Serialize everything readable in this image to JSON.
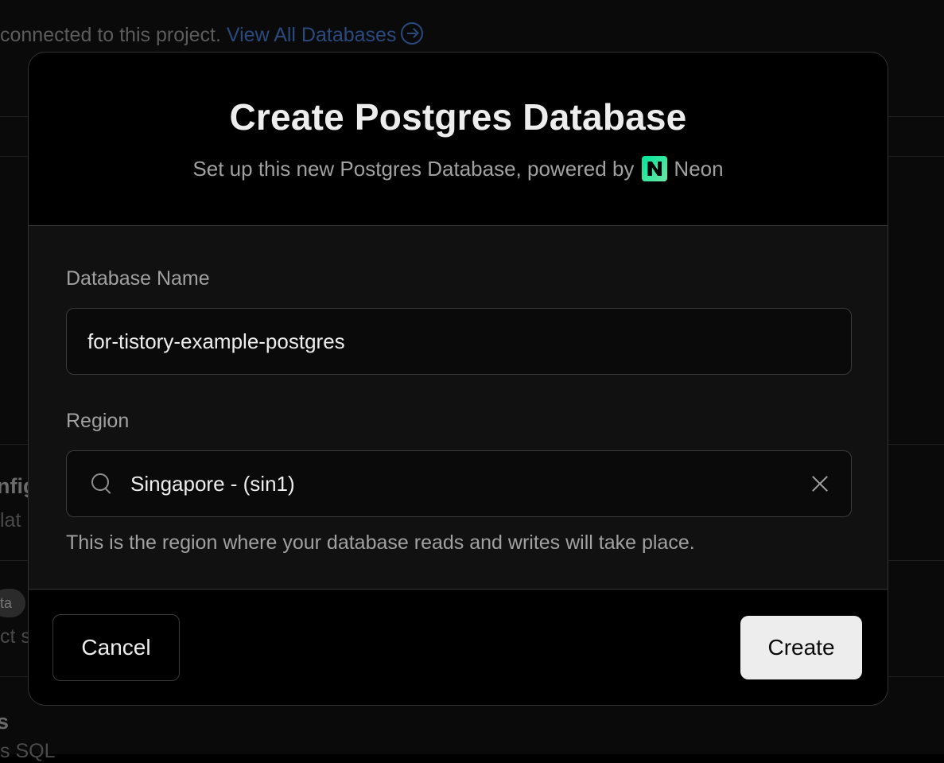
{
  "background": {
    "top_text": "connected to this project.",
    "top_link": "View All Databases",
    "fragment_1": "nfig",
    "fragment_2": "lat",
    "fragment_3": "ct s",
    "fragment_4": "s",
    "fragment_5": "s SQL",
    "pill": "ta"
  },
  "modal": {
    "title": "Create Postgres Database",
    "subtitle": "Set up this new Postgres Database, powered by",
    "provider": "Neon",
    "database_name_label": "Database Name",
    "database_name_value": "for-tistory-example-postgres",
    "region_label": "Region",
    "region_value": "Singapore - (sin1)",
    "region_help": "This is the region where your database reads and writes will take place.",
    "cancel_label": "Cancel",
    "create_label": "Create"
  },
  "colors": {
    "neon_brand": "#00e599",
    "link": "#2a4a7e",
    "primary_button": "#ededed"
  }
}
